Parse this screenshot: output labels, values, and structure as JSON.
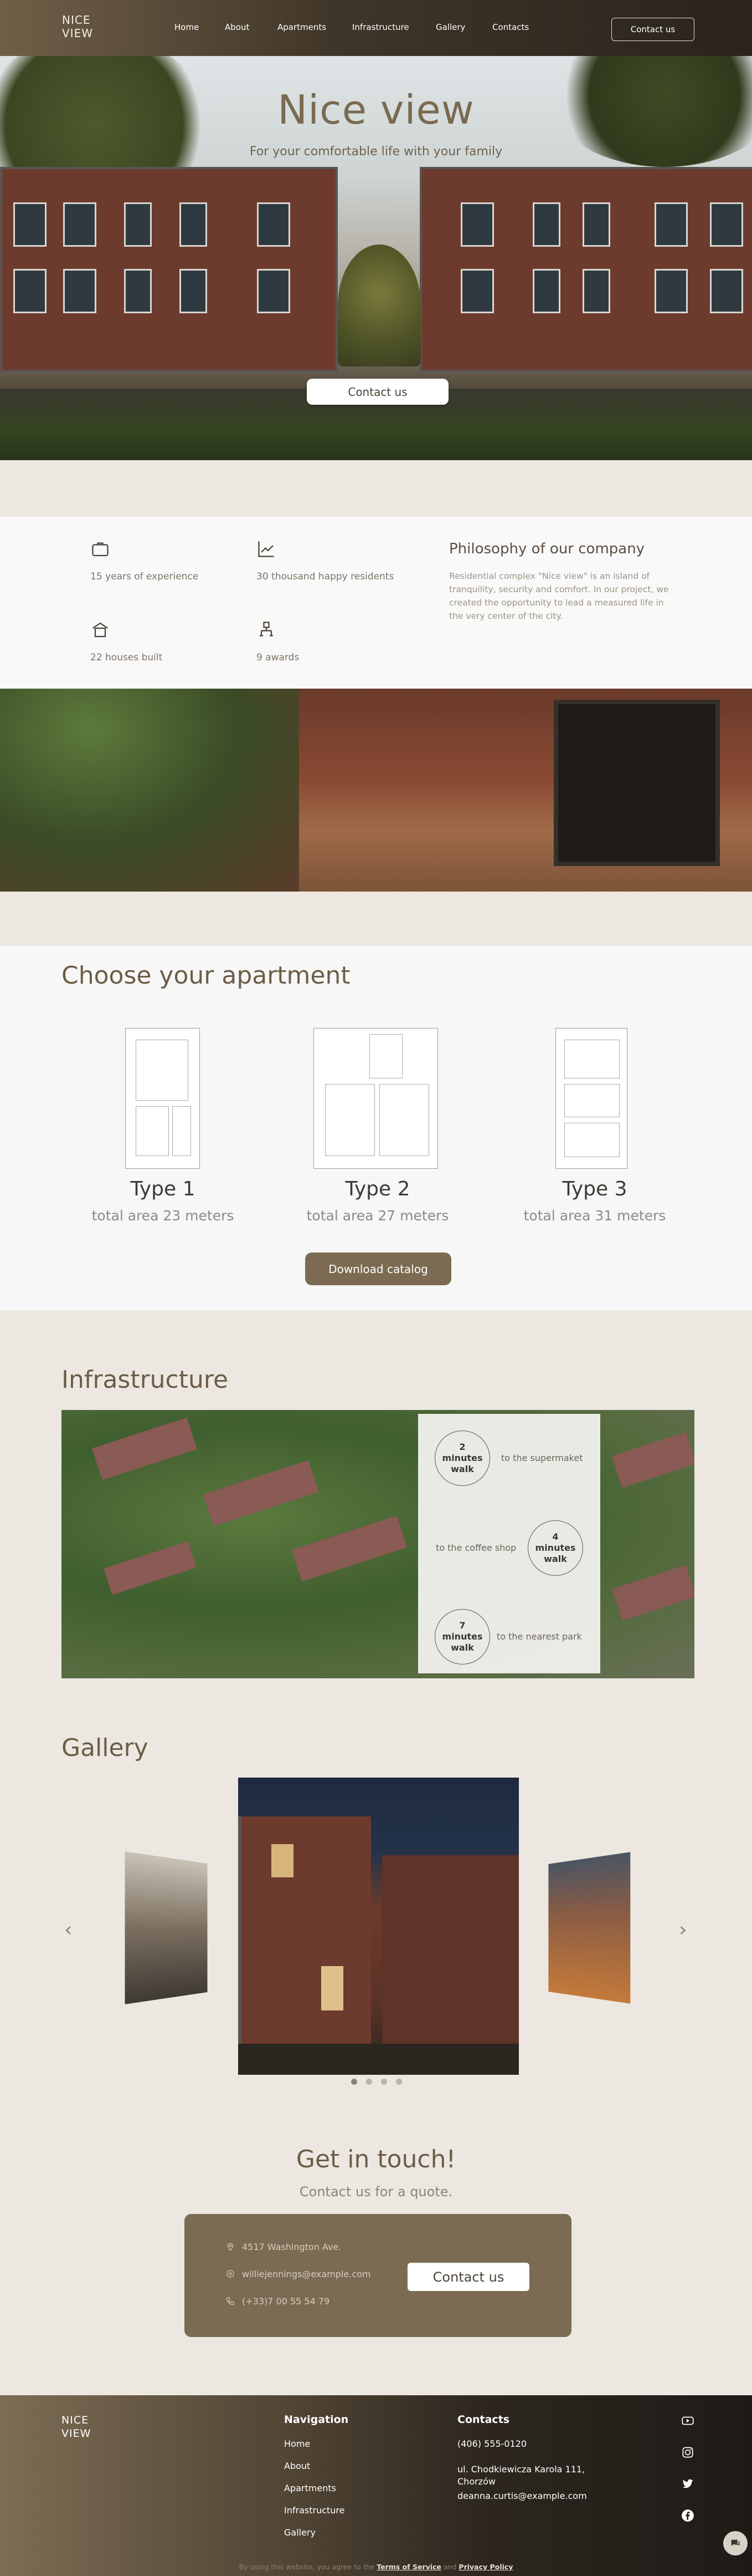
{
  "header": {
    "logo_line1": "NICE",
    "logo_line2": "VIEW",
    "nav": [
      "Home",
      "About",
      "Apartments",
      "Infrastructure",
      "Gallery",
      "Contacts"
    ],
    "contact_button": "Contact us"
  },
  "hero": {
    "title": "Nice view",
    "subtitle": "For your comfortable life with your family",
    "button": "Contact us"
  },
  "stats": {
    "items": [
      {
        "icon": "briefcase-icon",
        "label": "15 years of experience"
      },
      {
        "icon": "chart-icon",
        "label": "30 thousand happy residents"
      },
      {
        "icon": "house-icon",
        "label": "22 houses built"
      },
      {
        "icon": "award-icon",
        "label": "9 awards"
      }
    ],
    "philosophy_title": "Philosophy of our company",
    "philosophy_text": "Residential complex \"Nice view\" is an island of tranquility, security and comfort. In our project, we created the opportunity to lead a measured life in the very center of the city."
  },
  "apartments": {
    "title": "Choose your apartment",
    "items": [
      {
        "type": "Type 1",
        "area": "total area 23 meters"
      },
      {
        "type": "Type 2",
        "area": "total area 27 meters"
      },
      {
        "type": "Type 3",
        "area": "total area 31 meters"
      }
    ],
    "catalog_button": "Download catalog"
  },
  "infrastructure": {
    "title": "Infrastructure",
    "items": [
      {
        "time": "2 minutes walk",
        "place": "to the supermaket"
      },
      {
        "time": "4 minutes walk",
        "place": "to the coffee shop"
      },
      {
        "time": "7 minutes walk",
        "place": "to the nearest park"
      }
    ]
  },
  "gallery": {
    "title": "Gallery",
    "prev": "‹",
    "next": "›",
    "slides_count": 4,
    "active_slide": 1
  },
  "contact": {
    "title": "Get in touch!",
    "subtitle": "Contact us for a quote.",
    "address": "4517 Washington Ave.",
    "email": "williejennings@example.com",
    "phone": "(+33)7 00 55 54 79",
    "button": "Contact us"
  },
  "footer": {
    "logo_line1": "NICE",
    "logo_line2": "VIEW",
    "nav_title": "Navigation",
    "nav": [
      "Home",
      "About",
      "Apartments",
      "Infrastructure",
      "Gallery"
    ],
    "contacts_title": "Contacts",
    "phone": "(406) 555-0120",
    "address_line1": "ul. Chodkiewicza Karola 111,",
    "address_line2": "Chorzów",
    "email": "deanna.curtis@example.com",
    "legal_prefix": "By using this website, you agree to the",
    "terms": "Terms of Service",
    "and": "and",
    "privacy": "Privacy Policy"
  },
  "colors": {
    "accent": "#7b6b53",
    "title": "#6c5d47",
    "background": "#ece8e1"
  }
}
